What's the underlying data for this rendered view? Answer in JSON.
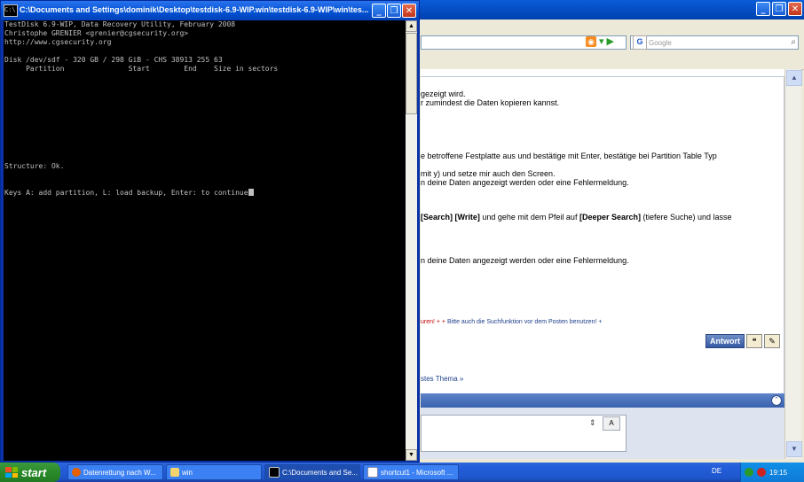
{
  "browser": {
    "search_placeholder": "Google",
    "post_lines": [
      {
        "text": "gezeigt wird."
      },
      {
        "text": "r zumindest die Daten kopieren kannst."
      },
      {
        "text": "e betroffene Festplatte aus und bestätige mit Enter, bestätige bei Partition Table Typ"
      },
      {
        "text": "mit y) und setze mir auch den Screen."
      },
      {
        "text": "n deine Daten angezeigt werden oder eine Fehlermeldung."
      },
      {
        "text": "n deine Daten angezeigt werden oder eine Fehlermeldung."
      }
    ],
    "search_line": {
      "b1": "[Search]",
      "b2": "[Write]",
      "mid": " und gehe mit dem Pfeil auf ",
      "b3": "[Deeper Search]",
      "end": " (tiefere Suche) und lasse"
    },
    "signature": {
      "part1": "uren! + +",
      "part2": " Bitte auch die Suchfunktion vor dem Posten benutzen! +"
    },
    "reply_button": "Antwort",
    "thread_nav": "stes Thema »"
  },
  "console": {
    "title": "C:\\Documents and Settings\\dominik\\Desktop\\testdisk-6.9-WIP.win\\testdisk-6.9-WIP\\win\\tes...",
    "lines": [
      "TestDisk 6.9-WIP, Data Recovery Utility, February 2008",
      "Christophe GRENIER <grenier@cgsecurity.org>",
      "http://www.cgsecurity.org",
      "",
      "Disk /dev/sdf - 320 GB / 298 GiB - CHS 38913 255 63",
      "     Partition               Start        End    Size in sectors",
      "",
      "",
      "",
      "",
      "",
      "",
      "",
      "",
      "",
      "",
      "Structure: Ok.",
      "",
      "",
      "Keys A: add partition, L: load backup, Enter: to continue"
    ]
  },
  "taskbar": {
    "start_label": "start",
    "tasks": [
      {
        "label": "Datenrettung nach W..."
      },
      {
        "label": "win"
      },
      {
        "label": "C:\\Documents and Se..."
      },
      {
        "label": "shortcut1 - Microsoft ..."
      }
    ],
    "language": "DE",
    "clock": "19:15"
  }
}
